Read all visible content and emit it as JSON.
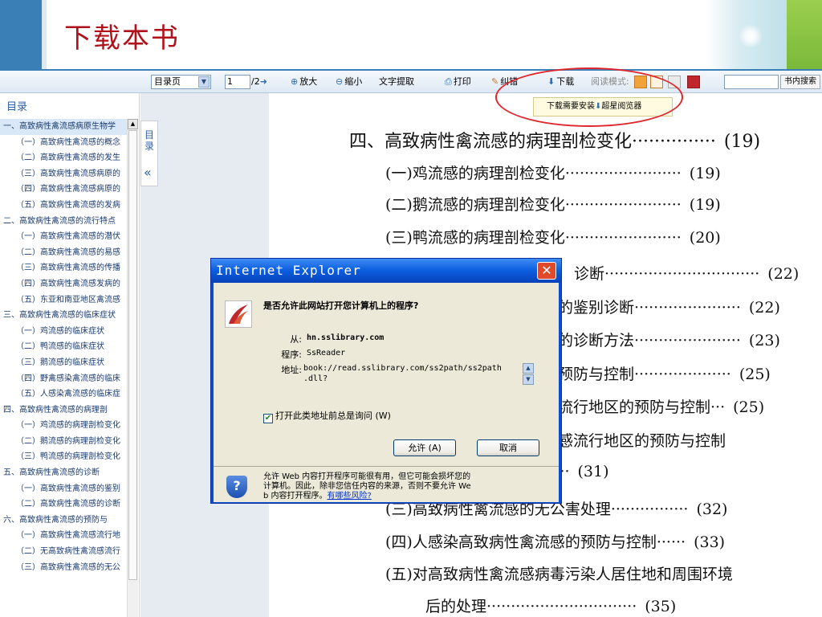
{
  "slide": {
    "title": "下载本书"
  },
  "toolbar": {
    "catalog_select": "目录页",
    "page_value": "1",
    "page_total": "/2",
    "zoom_in": "放大",
    "zoom_out": "缩小",
    "text_extract": "文字提取",
    "print": "打印",
    "correct": "纠错",
    "download": "下载",
    "read_mode": "阅读模式:",
    "search_button": "书内搜索",
    "tooltip": "下载需要安装",
    "tooltip_link": "超星阅览器"
  },
  "sidebar": {
    "title": "目录",
    "collapse_label": "目录",
    "collapse_arrow": "«",
    "items": [
      "一、高致病性禽流感病原生物学",
      "（一）高致病性禽流感的概念",
      "（二）高致病性禽流感的发生",
      "（三）高致病性禽流感病原的",
      "（四）高致病性禽流感病原的",
      "（五）高致病性禽流感的发病",
      "二、高致病性禽流感的流行特点",
      "（一）高致病性禽流感的潜伏",
      "（二）高致病性禽流感的易感",
      "（三）高致病性禽流感的传播",
      "（四）高致病性禽流感发病的",
      "（五）东亚和南亚地区禽流感",
      "三、高致病性禽流感的临床症状",
      "（一）鸡流感的临床症状",
      "（二）鸭流感的临床症状",
      "（三）鹅流感的临床症状",
      "（四）野禽感染禽流感的临床",
      "（五）人感染禽流感的临床症",
      "四、高致病性禽流感的病理剖",
      "（一）鸡流感的病理剖检变化",
      "（二）鹅流感的病理剖检变化",
      "（三）鸭流感的病理剖检变化",
      "五、高致病性禽流感的诊断",
      "（一）高致病性禽流感的鉴别",
      "（二）高致病性禽流感的诊断",
      "六、高致病性禽流感的预防与",
      "（一）高致病性禽流感流行地",
      "（二）无高致病性禽流感流行",
      "（三）高致病性禽流感的无公"
    ]
  },
  "page": {
    "lines": [
      {
        "text": "四、高致病性禽流感的病理剖检变化",
        "dots": "···············",
        "page": "(19)"
      },
      {
        "text": "(一)鸡流感的病理剖检变化",
        "dots": "························",
        "page": "(19)"
      },
      {
        "text": "(二)鹅流感的病理剖检变化",
        "dots": "························",
        "page": "(19)"
      },
      {
        "text": "(三)鸭流感的病理剖检变化",
        "dots": "························",
        "page": "(20)"
      },
      {
        "text": "诊断",
        "dots": "································",
        "page": "(22)"
      },
      {
        "text": "的鉴别诊断",
        "dots": "······················",
        "page": "(22)"
      },
      {
        "text": "的诊断方法",
        "dots": "······················",
        "page": "(23)"
      },
      {
        "text": "预防与控制",
        "dots": "····················",
        "page": "(25)"
      },
      {
        "text": "流行地区的预防与控制",
        "dots": "···",
        "page": "(25)"
      },
      {
        "text": "感流行地区的预防与控制",
        "dots": "",
        "page": ""
      },
      {
        "text": "",
        "dots": "······································",
        "page": "(31)"
      },
      {
        "text": "(三)高致病性禽流感的无公害处理",
        "dots": "················",
        "page": "(32)"
      },
      {
        "text": "(四)人感染高致病性禽流感的预防与控制",
        "dots": "······",
        "page": "(33)"
      },
      {
        "text": "(五)对高致病性禽流感病毒污染人居住地和周围环境",
        "dots": "",
        "page": ""
      },
      {
        "text": "后的处理",
        "dots": "·······························",
        "page": "(35)"
      }
    ]
  },
  "dialog": {
    "title": "Internet Explorer",
    "close": "✕",
    "question": "是否允许此网站打开您计算机上的程序?",
    "from_label": "从:",
    "from_value": "hn.sslibrary.com",
    "program_label": "程序:",
    "program_value": "SsReader",
    "address_label": "地址:",
    "address_value_1": "book://read.sslibrary.com/ss2path/ss2path",
    "address_value_2": ".dll?",
    "checkbox_label": "打开此类地址前总是询问 (W)",
    "allow_button": "允许 (A)",
    "cancel_button": "取消",
    "warning_1": "允许 Web 内容打开程序可能很有用，但它可能会损坏您的",
    "warning_2": "计算机。因此，除非您信任内容的来源，否则不要允许 We",
    "warning_3": "b 内容打开程序。",
    "warning_link": "有哪些风险?"
  },
  "colors": {
    "title_red": "#b0121b",
    "header_blue": "#3a7fb6",
    "ie_blue": "#0a5ce0",
    "annotation_red": "#e0262b"
  }
}
